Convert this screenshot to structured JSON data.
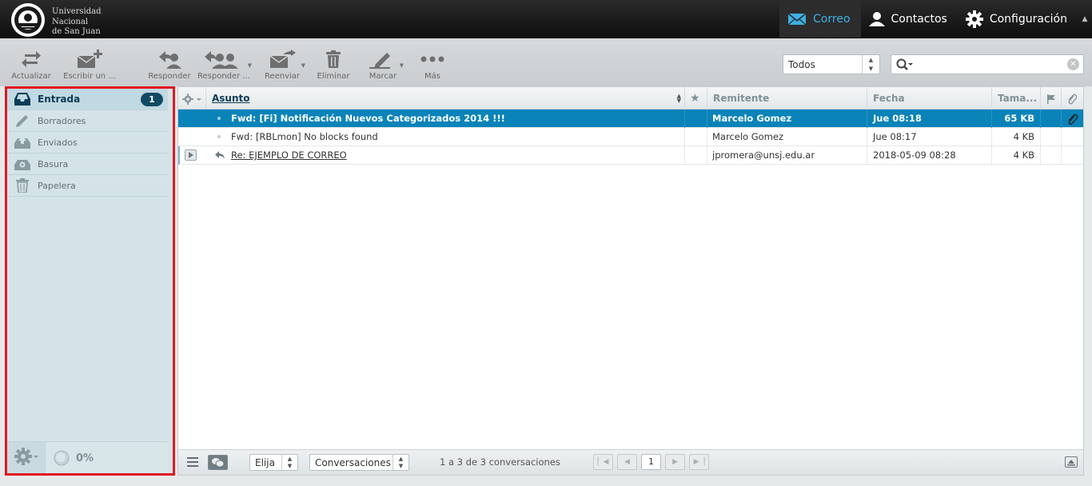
{
  "header": {
    "logo_text": [
      "Universidad",
      "Nacional",
      "de San Juan"
    ],
    "nav": [
      {
        "label": "Correo",
        "icon": "mail-icon",
        "active": true
      },
      {
        "label": "Contactos",
        "icon": "user-icon",
        "active": false
      },
      {
        "label": "Configuración",
        "icon": "gear-icon",
        "active": false
      }
    ]
  },
  "toolbar": {
    "buttons": [
      {
        "label": "Actualizar",
        "icon": "refresh-icon"
      },
      {
        "label": "Escribir un ...",
        "icon": "compose-icon"
      },
      {
        "label": "Responder",
        "icon": "reply-icon"
      },
      {
        "label": "Responder ...",
        "icon": "reply-all-icon"
      },
      {
        "label": "Reenviar",
        "icon": "forward-icon"
      },
      {
        "label": "Eliminar",
        "icon": "trash-icon"
      },
      {
        "label": "Marcar",
        "icon": "mark-icon"
      },
      {
        "label": "Más",
        "icon": "more-icon"
      }
    ],
    "filter_value": "Todos",
    "search_value": ""
  },
  "sidebar": {
    "folders": [
      {
        "label": "Entrada",
        "icon": "inbox-icon",
        "badge": "1",
        "active": true
      },
      {
        "label": "Borradores",
        "icon": "pencil-icon",
        "badge": "",
        "active": false
      },
      {
        "label": "Enviados",
        "icon": "sent-icon",
        "badge": "",
        "active": false
      },
      {
        "label": "Basura",
        "icon": "junk-icon",
        "badge": "",
        "active": false
      },
      {
        "label": "Papelera",
        "icon": "trash-icon",
        "badge": "",
        "active": false
      }
    ],
    "quota": "0%"
  },
  "list": {
    "columns": {
      "subject": "Asunto",
      "from": "Remitente",
      "date": "Fecha",
      "size": "Tama..."
    },
    "rows": [
      {
        "subject": "Fwd: [Fi] Notificación Nuevos Categorizados 2014 !!!",
        "from": "Marcelo Gomez",
        "date": "Jue 08:18",
        "size": "65 KB",
        "selected": true,
        "attachment": true,
        "replied": false,
        "thread": false
      },
      {
        "subject": "Fwd: [RBLmon] No blocks found",
        "from": "Marcelo Gomez",
        "date": "Jue 08:17",
        "size": "4 KB",
        "selected": false,
        "attachment": false,
        "replied": false,
        "thread": false
      },
      {
        "subject": "Re: EJEMPLO DE CORREO",
        "from": "jpromera@unsj.edu.ar",
        "date": "2018-05-09 08:28",
        "size": "4 KB",
        "selected": false,
        "attachment": false,
        "replied": true,
        "thread": true
      }
    ]
  },
  "footer": {
    "select_label": "Elija",
    "mode_label": "Conversaciones",
    "count_text": "1 a 3 de 3 conversaciones",
    "page": "1"
  }
}
